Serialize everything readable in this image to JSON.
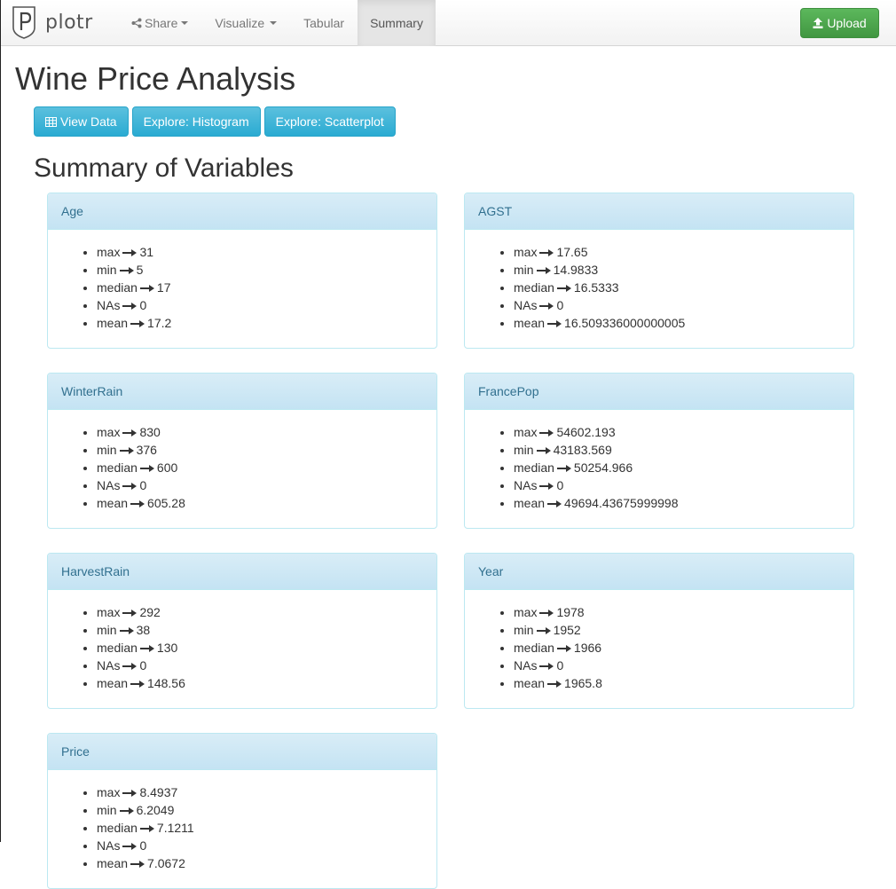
{
  "app": {
    "brand": "plotr"
  },
  "nav": {
    "items": [
      {
        "label": "Share",
        "icon": "share-icon",
        "dropdown": true,
        "active": false
      },
      {
        "label": "Visualize",
        "dropdown": true,
        "active": false
      },
      {
        "label": "Tabular",
        "dropdown": false,
        "active": false
      },
      {
        "label": "Summary",
        "dropdown": false,
        "active": true
      }
    ],
    "upload_label": "Upload",
    "upload_icon": "upload-icon"
  },
  "page": {
    "title": "Wine Price Analysis",
    "actions": [
      {
        "label": "View Data",
        "icon": "table-icon"
      },
      {
        "label": "Explore: Histogram"
      },
      {
        "label": "Explore: Scatterplot"
      }
    ],
    "section_title": "Summary of Variables"
  },
  "variables": [
    {
      "name": "Age",
      "stats": [
        {
          "key": "max",
          "value": "31"
        },
        {
          "key": "min",
          "value": "5"
        },
        {
          "key": "median",
          "value": "17"
        },
        {
          "key": "NAs",
          "value": "0"
        },
        {
          "key": "mean",
          "value": "17.2"
        }
      ]
    },
    {
      "name": "AGST",
      "stats": [
        {
          "key": "max",
          "value": "17.65"
        },
        {
          "key": "min",
          "value": "14.9833"
        },
        {
          "key": "median",
          "value": "16.5333"
        },
        {
          "key": "NAs",
          "value": "0"
        },
        {
          "key": "mean",
          "value": "16.509336000000005"
        }
      ]
    },
    {
      "name": "WinterRain",
      "stats": [
        {
          "key": "max",
          "value": "830"
        },
        {
          "key": "min",
          "value": "376"
        },
        {
          "key": "median",
          "value": "600"
        },
        {
          "key": "NAs",
          "value": "0"
        },
        {
          "key": "mean",
          "value": "605.28"
        }
      ]
    },
    {
      "name": "FrancePop",
      "stats": [
        {
          "key": "max",
          "value": "54602.193"
        },
        {
          "key": "min",
          "value": "43183.569"
        },
        {
          "key": "median",
          "value": "50254.966"
        },
        {
          "key": "NAs",
          "value": "0"
        },
        {
          "key": "mean",
          "value": "49694.43675999998"
        }
      ]
    },
    {
      "name": "HarvestRain",
      "stats": [
        {
          "key": "max",
          "value": "292"
        },
        {
          "key": "min",
          "value": "38"
        },
        {
          "key": "median",
          "value": "130"
        },
        {
          "key": "NAs",
          "value": "0"
        },
        {
          "key": "mean",
          "value": "148.56"
        }
      ]
    },
    {
      "name": "Year",
      "stats": [
        {
          "key": "max",
          "value": "1978"
        },
        {
          "key": "min",
          "value": "1952"
        },
        {
          "key": "median",
          "value": "1966"
        },
        {
          "key": "NAs",
          "value": "0"
        },
        {
          "key": "mean",
          "value": "1965.8"
        }
      ]
    },
    {
      "name": "Price",
      "stats": [
        {
          "key": "max",
          "value": "8.4937"
        },
        {
          "key": "min",
          "value": "6.2049"
        },
        {
          "key": "median",
          "value": "7.1211"
        },
        {
          "key": "NAs",
          "value": "0"
        },
        {
          "key": "mean",
          "value": "7.0672"
        }
      ]
    }
  ],
  "colors": {
    "primary_info": "#5bc0de",
    "success": "#5cb85c",
    "panel_heading_bg": "#d9edf7",
    "panel_heading_text": "#31708f",
    "panel_border": "#bce8f1"
  }
}
